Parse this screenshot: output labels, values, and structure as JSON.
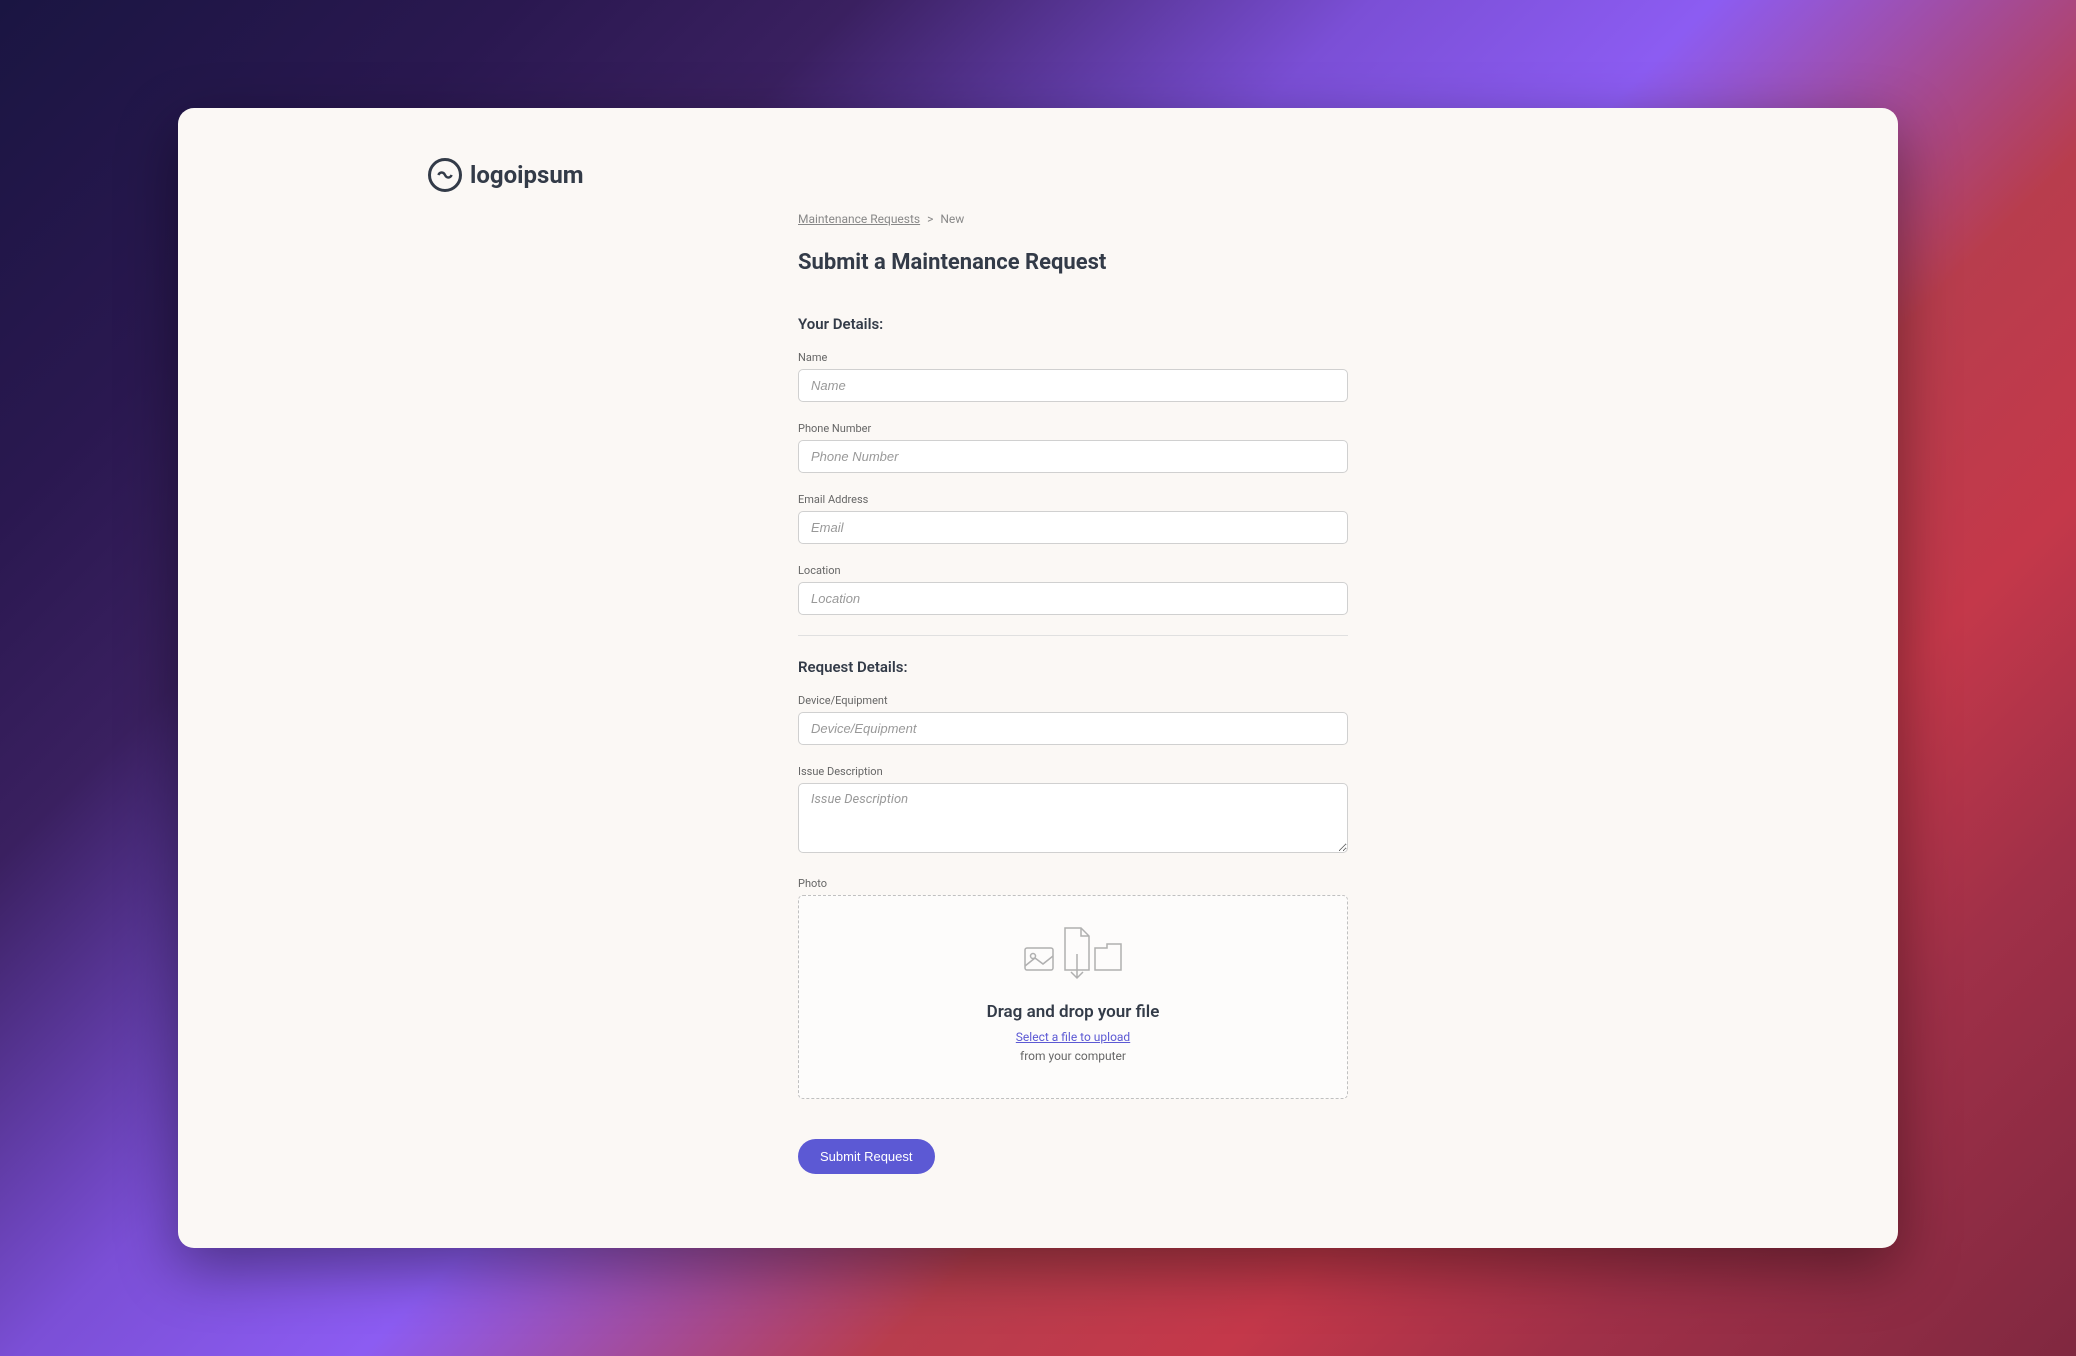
{
  "logo": {
    "text": "logoipsum"
  },
  "breadcrumb": {
    "parent": "Maintenance Requests",
    "separator": ">",
    "current": "New"
  },
  "page": {
    "title": "Submit a Maintenance Request"
  },
  "sections": {
    "your_details": {
      "title": "Your Details:",
      "fields": {
        "name": {
          "label": "Name",
          "placeholder": "Name"
        },
        "phone": {
          "label": "Phone Number",
          "placeholder": "Phone Number"
        },
        "email": {
          "label": "Email Address",
          "placeholder": "Email"
        },
        "location": {
          "label": "Location",
          "placeholder": "Location"
        }
      }
    },
    "request_details": {
      "title": "Request Details:",
      "fields": {
        "device": {
          "label": "Device/Equipment",
          "placeholder": "Device/Equipment"
        },
        "issue": {
          "label": "Issue Description",
          "placeholder": "Issue Description"
        },
        "photo": {
          "label": "Photo",
          "upload_title": "Drag and drop your file",
          "upload_link": "Select a file to upload",
          "upload_subtext": "from your computer"
        }
      }
    }
  },
  "actions": {
    "submit": "Submit Request"
  }
}
